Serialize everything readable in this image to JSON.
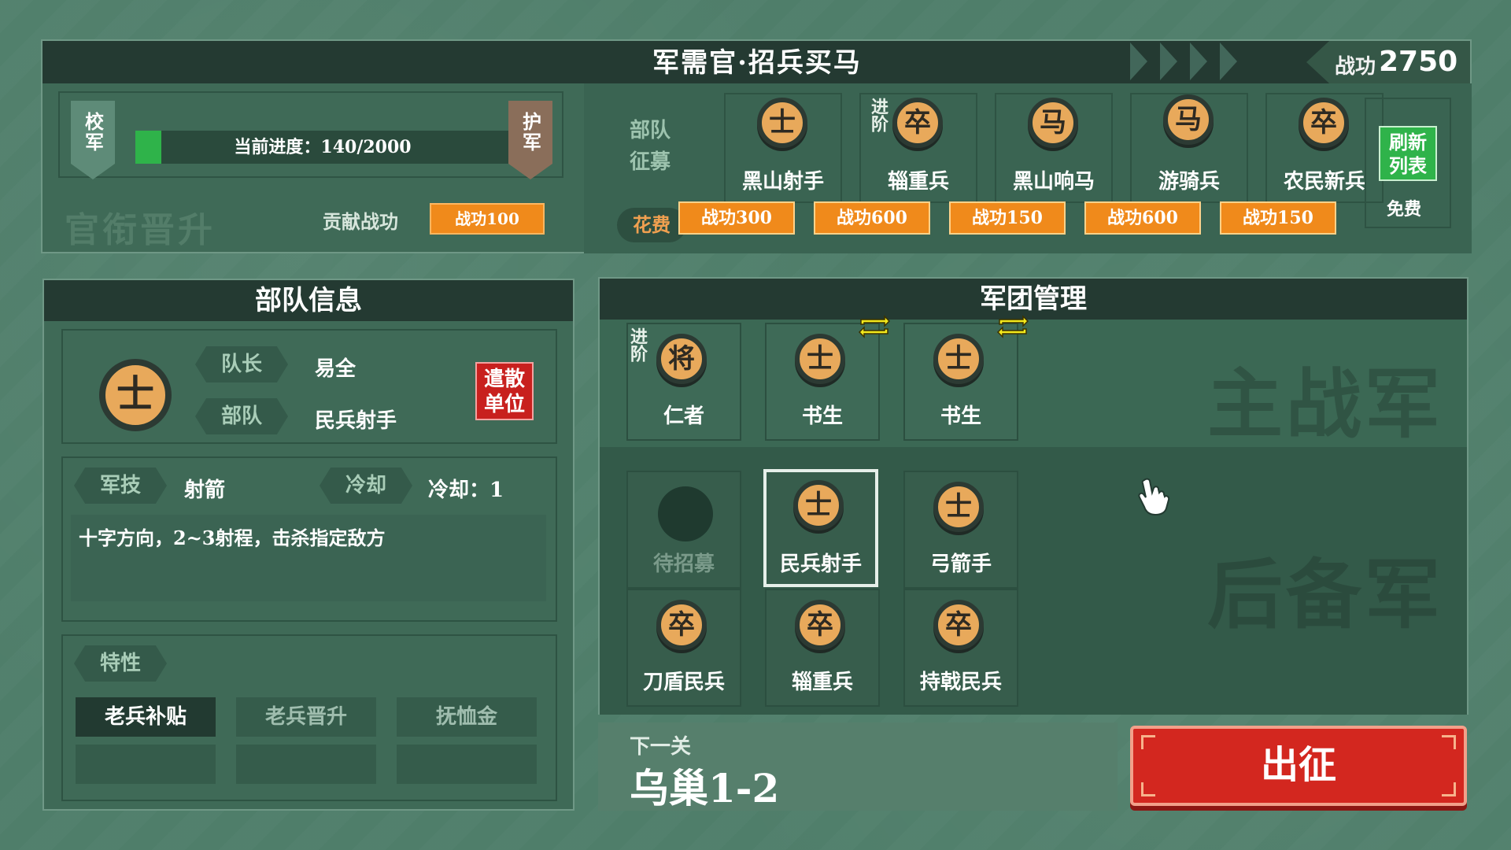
{
  "top": {
    "title": "军需官·招兵买马",
    "score_label": "战功",
    "score_value": "2750"
  },
  "rank": {
    "left_flag": "校军",
    "right_flag": "护军",
    "progress_text": "当前进度：140/2000",
    "progress_fraction": 0.07,
    "bg_text": "官衔晋升",
    "contribute_label": "贡献战功",
    "contribute_button": "战功100"
  },
  "recruit": {
    "label": "部队征募",
    "cost_label": "花费",
    "promote_tag": "进阶",
    "cards": [
      {
        "token": "士",
        "name": "黑山射手",
        "cost": "战功300"
      },
      {
        "token": "卒",
        "name": "辎重兵",
        "cost": "战功600"
      },
      {
        "token": "马",
        "name": "黑山响马",
        "cost": "战功150"
      },
      {
        "token": "马",
        "name": "游骑兵",
        "cost": "战功600"
      },
      {
        "token": "卒",
        "name": "农民新兵",
        "cost": "战功150"
      }
    ],
    "refresh_button": "刷新列表",
    "refresh_cost": "免费"
  },
  "unit_info": {
    "header": "部队信息",
    "token": "士",
    "captain_label": "队长",
    "captain_value": "易全",
    "unit_label": "部队",
    "unit_value": "民兵射手",
    "dismiss_button": "遣散单位",
    "skill_label": "军技",
    "skill_value": "射箭",
    "cooldown_label": "冷却",
    "cooldown_value": "冷却：1",
    "description": "十字方向，2~3射程，击杀指定敌方",
    "trait_label": "特性",
    "traits": [
      "老兵补贴",
      "老兵晋升",
      "抚恤金"
    ]
  },
  "legion": {
    "header": "军团管理",
    "main_watermark": "主战军",
    "reserve_watermark": "后备军",
    "promote_tag": "进阶",
    "main": [
      {
        "token": "将",
        "name": "仁者"
      },
      {
        "token": "士",
        "name": "书生"
      },
      {
        "token": "士",
        "name": "书生"
      }
    ],
    "reserve": [
      {
        "token": "",
        "name": "待招募"
      },
      {
        "token": "士",
        "name": "民兵射手"
      },
      {
        "token": "士",
        "name": "弓箭手"
      },
      {
        "token": "卒",
        "name": "刀盾民兵"
      },
      {
        "token": "卒",
        "name": "辎重兵"
      },
      {
        "token": "卒",
        "name": "持戟民兵"
      }
    ]
  },
  "next": {
    "label": "下一关",
    "stage": "乌巢1-2"
  },
  "deploy_button": "出征",
  "colors": {
    "background": "#4f7e6a",
    "orange": "#f08a1b",
    "green": "#2fb34a",
    "red": "#d3271f",
    "token": "#e8a95b"
  }
}
